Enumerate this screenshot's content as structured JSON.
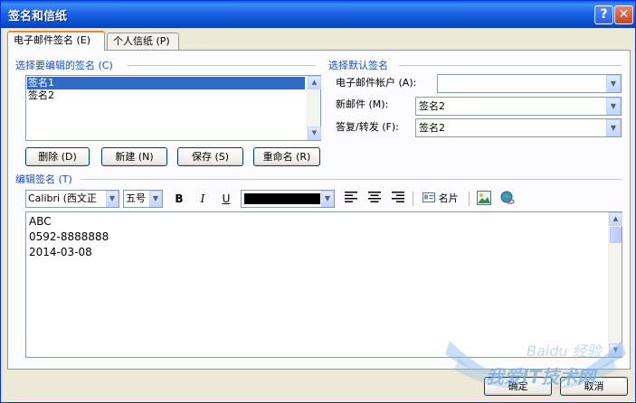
{
  "window": {
    "title": "签名和信纸",
    "help_symbol": "?",
    "close_symbol": "✕"
  },
  "tabs": [
    {
      "label": "电子邮件签名 (E)",
      "active": true
    },
    {
      "label": "个人信纸 (P)",
      "active": false
    }
  ],
  "signature_select": {
    "label": "选择要编辑的签名 (C)",
    "items": [
      {
        "label": "签名1",
        "selected": true
      },
      {
        "label": "签名2",
        "selected": false
      }
    ]
  },
  "buttons": {
    "delete": "删除 (D)",
    "new": "新建 (N)",
    "save": "保存 (S)",
    "rename": "重命名 (R)"
  },
  "default_signature": {
    "label": "选择默认签名",
    "account_label": "电子邮件帐户 (A):",
    "account_value": "",
    "new_messages_label": "新邮件 (M):",
    "new_messages_value": "签名2",
    "replies_label": "答复/转发 (F):",
    "replies_value": "签名2"
  },
  "edit_signature": {
    "label": "编辑签名 (T)",
    "font_value": "Calibri (西文正",
    "size_value": "五号",
    "bold": "B",
    "italic": "I",
    "underline": "U",
    "font_color": "#000000",
    "business_card_label": "名片",
    "lines": [
      "ABC",
      "0592-8888888",
      "2014-03-08"
    ]
  },
  "footer": {
    "ok": "确定",
    "cancel": "取消"
  },
  "watermark": {
    "text_main": "我爱IT技术网",
    "text_top": "Baidu 经验"
  }
}
